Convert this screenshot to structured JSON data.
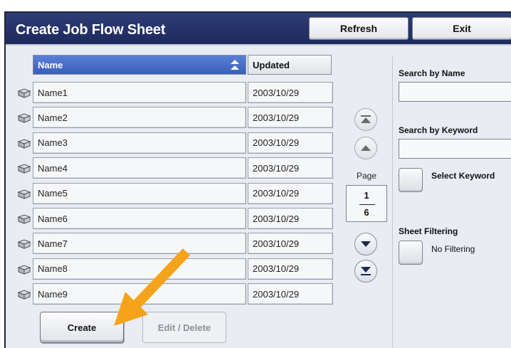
{
  "window": {
    "title": "Create Job Flow Sheet"
  },
  "toolbar": {
    "refresh_label": "Refresh",
    "exit_label": "Exit"
  },
  "table": {
    "headers": {
      "name": "Name",
      "updated": "Updated"
    },
    "rows": [
      {
        "name": "Name1",
        "updated": "2003/10/29"
      },
      {
        "name": "Name2",
        "updated": "2003/10/29"
      },
      {
        "name": "Name3",
        "updated": "2003/10/29"
      },
      {
        "name": "Name4",
        "updated": "2003/10/29"
      },
      {
        "name": "Name5",
        "updated": "2003/10/29"
      },
      {
        "name": "Name6",
        "updated": "2003/10/29"
      },
      {
        "name": "Name7",
        "updated": "2003/10/29"
      },
      {
        "name": "Name8",
        "updated": "2003/10/29"
      },
      {
        "name": "Name9",
        "updated": "2003/10/29"
      }
    ]
  },
  "pager": {
    "label": "Page",
    "current": "1",
    "total": "6"
  },
  "side": {
    "search_by_name_label": "Search by Name",
    "search_by_name_value": "",
    "search_by_keyword_label": "Search by Keyword",
    "search_by_keyword_value": "",
    "select_keyword_label": "Select Keyword",
    "sheet_filtering_label": "Sheet Filtering",
    "sheet_filtering_value": "No Filtering"
  },
  "actions": {
    "create_label": "Create",
    "edit_delete_label": "Edit / Delete"
  },
  "colors": {
    "title_bar": "#1e2a5c",
    "selected_header": "#3a5fb8",
    "annotation_arrow": "#f5a31a"
  }
}
